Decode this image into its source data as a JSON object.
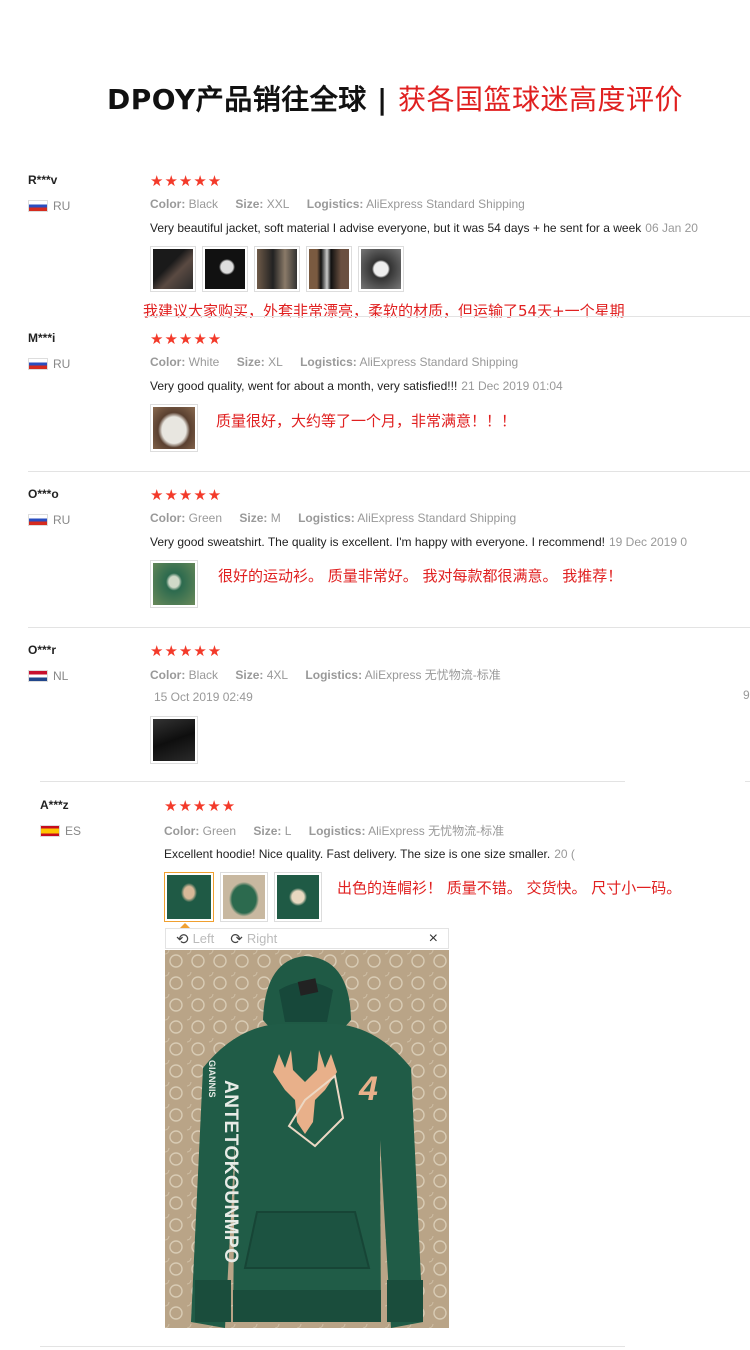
{
  "header": {
    "title_main": "DPOY产品销往全球 | ",
    "title_red": "获各国篮球迷高度评价"
  },
  "labels": {
    "color": "Color:",
    "size": "Size:",
    "logistics": "Logistics:"
  },
  "reviews": [
    {
      "user": "R***v",
      "country": "RU",
      "stars": "★★★★★",
      "color": "Black",
      "size": "XXL",
      "logistics": "AliExpress Standard Shipping",
      "comment": "Very beautiful jacket, soft material I advise everyone, but it was 54 days + he sent for a week",
      "date": "06 Jan 20",
      "translation": "我建议大家购买，外套非常漂亮，柔软的材质，但运输了54天+一个星期"
    },
    {
      "user": "M***i",
      "country": "RU",
      "stars": "★★★★★",
      "color": "White",
      "size": "XL",
      "logistics": "AliExpress Standard Shipping",
      "comment": "Very good quality, went for about a month, very satisfied!!!",
      "date": "21 Dec 2019 01:04",
      "translation": "质量很好，大约等了一个月，非常满意！！！"
    },
    {
      "user": "O***o",
      "country": "RU",
      "stars": "★★★★★",
      "color": "Green",
      "size": "M",
      "logistics": "AliExpress Standard Shipping",
      "comment": "Very good sweatshirt. The quality is excellent. I'm happy with everyone. I recommend!",
      "date": "19 Dec 2019 0",
      "translation": "很好的运动衫。 质量非常好。 我对每款都很满意。 我推荐！"
    },
    {
      "user": "O***r",
      "country": "NL",
      "stars": "★★★★★",
      "color": "Black",
      "size": "4XL",
      "logistics": "AliExpress 无忧物流-标准",
      "comment": "",
      "date": "15 Oct 2019 02:49",
      "edge": "9"
    },
    {
      "user": "A***z",
      "country": "ES",
      "stars": "★★★★★",
      "color": "Green",
      "size": "L",
      "logistics": "AliExpress 无忧物流-标准",
      "comment": "Excellent hoodie! Nice quality. Fast delivery. The size is one size smaller.",
      "date": "20 (",
      "translation": "出色的连帽衫！ 质量不错。 交货快。 尺寸小一码。"
    }
  ],
  "viewer": {
    "left": "Left",
    "right": "Right",
    "close": "×"
  },
  "photo_print": {
    "name": "ANTETOKOUNMPO",
    "small": "GIANNIS",
    "number": "4"
  },
  "colors": {
    "accent": "#e02020",
    "stars": "#f33a2a",
    "hoodie": "#1f5a45"
  }
}
